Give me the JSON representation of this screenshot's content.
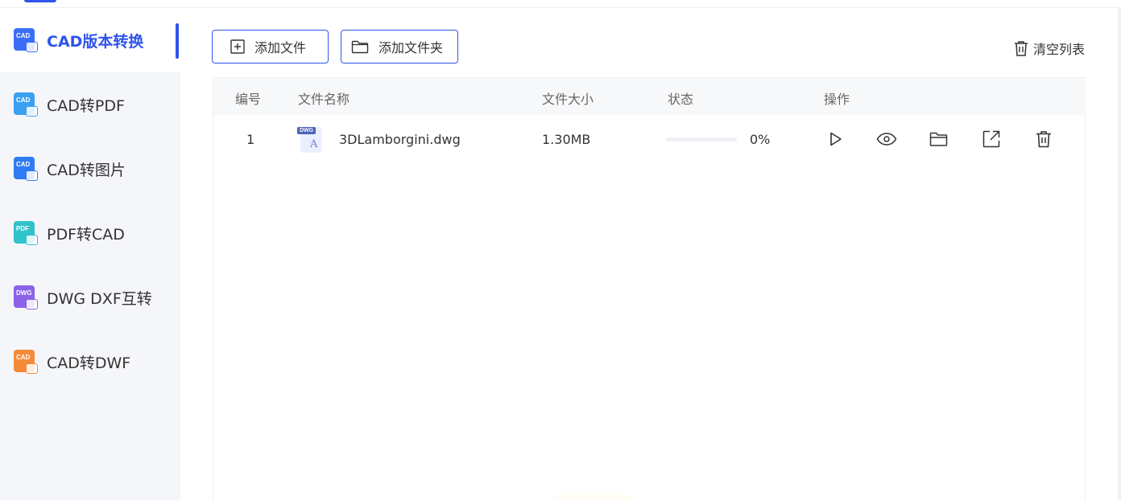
{
  "sidebar": {
    "items": [
      {
        "label": "CAD版本转换",
        "icon_tag": "CAD",
        "color": "#3b6ef5",
        "active": true
      },
      {
        "label": "CAD转PDF",
        "icon_tag": "CAD",
        "color": "#3aa0f0",
        "active": false
      },
      {
        "label": "CAD转图片",
        "icon_tag": "CAD",
        "color": "#2f7cf2",
        "active": false
      },
      {
        "label": "PDF转CAD",
        "icon_tag": "PDF",
        "color": "#30c3c9",
        "active": false
      },
      {
        "label": "DWG DXF互转",
        "icon_tag": "DWG",
        "color": "#8a63e8",
        "active": false
      },
      {
        "label": "CAD转DWF",
        "icon_tag": "CAD",
        "color": "#f58a3a",
        "active": false
      }
    ]
  },
  "toolbar": {
    "add_file": "添加文件",
    "add_folder": "添加文件夹",
    "clear_list": "清空列表"
  },
  "table": {
    "headers": {
      "index": "编号",
      "name": "文件名称",
      "size": "文件大小",
      "status": "状态",
      "actions": "操作"
    },
    "rows": [
      {
        "index": "1",
        "file_badge": "DWG",
        "name": "3DLamborgini.dwg",
        "size": "1.30MB",
        "progress_percent": 0,
        "progress_label": "0%"
      }
    ]
  },
  "icons": {
    "actions": [
      "play-icon",
      "eye-icon",
      "folder-open-icon",
      "external-link-icon",
      "trash-icon"
    ]
  },
  "colors": {
    "accent": "#2f54eb",
    "sidebar_bg": "#f5f6fa",
    "header_bg": "#f7f8fa"
  }
}
